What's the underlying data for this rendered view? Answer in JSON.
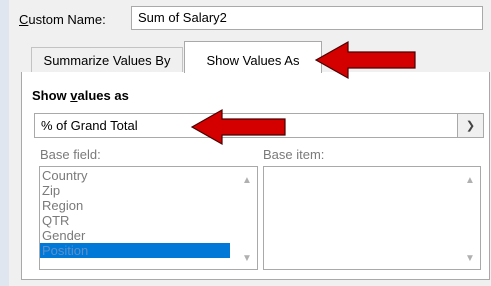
{
  "custom_name": {
    "label_accel": "C",
    "label_rest": "ustom Name:",
    "value": "Sum of Salary2"
  },
  "tabs": [
    {
      "label": "Summarize Values By"
    },
    {
      "label": "Show Values As"
    }
  ],
  "section": {
    "title_pre": "Show ",
    "title_accel": "v",
    "title_post": "alues as"
  },
  "calculation": {
    "selected": "% of Grand Total"
  },
  "base_field": {
    "label": "Base field:",
    "items": [
      "Country",
      "Zip",
      "Region",
      "QTR",
      "Gender",
      "Position"
    ],
    "selected_index": 5
  },
  "base_item": {
    "label": "Base item:"
  },
  "icons": {
    "dropdown": "chevron-down-icon",
    "scroll_up": "scroll-up-icon",
    "scroll_down": "scroll-down-icon"
  },
  "colors": {
    "arrow": "#d40000",
    "selection": "#0078d7"
  }
}
